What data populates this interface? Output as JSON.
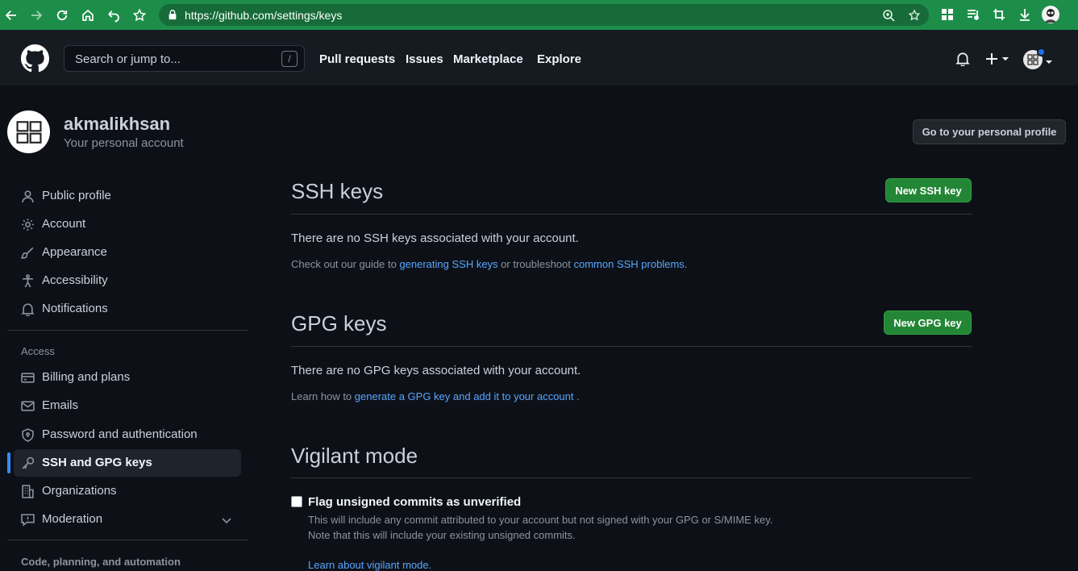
{
  "browser": {
    "url": "https://github.com/settings/keys"
  },
  "header": {
    "search_placeholder": "Search or jump to...",
    "search_shortcut": "/",
    "nav": [
      "Pull requests",
      "Issues",
      "Marketplace",
      "Explore"
    ]
  },
  "account": {
    "username": "akmalikhsan",
    "subtitle": "Your personal account",
    "profile_button": "Go to your personal profile"
  },
  "sidebar": {
    "items_top": [
      {
        "label": "Public profile",
        "icon": "person-icon"
      },
      {
        "label": "Account",
        "icon": "gear-icon"
      },
      {
        "label": "Appearance",
        "icon": "paintbrush-icon"
      },
      {
        "label": "Accessibility",
        "icon": "accessibility-icon"
      },
      {
        "label": "Notifications",
        "icon": "bell-icon"
      }
    ],
    "access_heading": "Access",
    "items_access": [
      {
        "label": "Billing and plans",
        "icon": "credit-card-icon"
      },
      {
        "label": "Emails",
        "icon": "mail-icon"
      },
      {
        "label": "Password and authentication",
        "icon": "shield-lock-icon"
      },
      {
        "label": "SSH and GPG keys",
        "icon": "key-icon",
        "active": true
      },
      {
        "label": "Organizations",
        "icon": "organization-icon"
      },
      {
        "label": "Moderation",
        "icon": "report-icon"
      }
    ],
    "code_heading": "Code, planning, and automation"
  },
  "ssh": {
    "title": "SSH keys",
    "button": "New SSH key",
    "empty": "There are no SSH keys associated with your account.",
    "note_prefix": "Check out our guide to ",
    "note_link1": "generating SSH keys",
    "note_middle": " or troubleshoot ",
    "note_link2": "common SSH problems",
    "note_suffix": "."
  },
  "gpg": {
    "title": "GPG keys",
    "button": "New GPG key",
    "empty": "There are no GPG keys associated with your account.",
    "note_prefix": "Learn how to ",
    "note_link": "generate a GPG key and add it to your account",
    "note_suffix": " ."
  },
  "vigilant": {
    "title": "Vigilant mode",
    "checkbox_label": "Flag unsigned commits as unverified",
    "checked": false,
    "desc1": "This will include any commit attributed to your account but not signed with your GPG or S/MIME key.",
    "desc2": "Note that this will include your existing unsigned commits.",
    "learn_link": "Learn about vigilant mode."
  },
  "colors": {
    "background": "#0d1117",
    "header": "#161b22",
    "browser_bar": "#1d8e49",
    "green_button": "#238636",
    "link": "#58a6ff",
    "active_indicator": "#388bfd"
  }
}
